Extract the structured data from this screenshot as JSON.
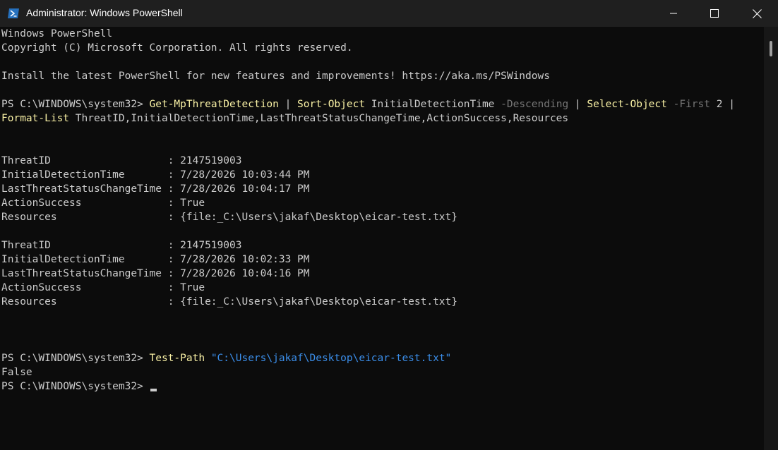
{
  "window": {
    "title": "Administrator: Windows PowerShell",
    "icon": "powershell-icon",
    "controls": [
      "minimize-icon",
      "maximize-icon",
      "close-icon"
    ]
  },
  "console": {
    "header": [
      "Windows PowerShell",
      "Copyright (C) Microsoft Corporation. All rights reserved.",
      "Install the latest PowerShell for new features and improvements! https://aka.ms/PSWindows"
    ],
    "prompt": "PS C:\\WINDOWS\\system32> ",
    "command1": {
      "cmd": "Get-MpThreatDetection",
      "pipe": " | ",
      "sort_cmd": "Sort-Object",
      "sort_arg": " InitialDetectionTime ",
      "sort_param": "-Descending",
      "select_cmd": "Select-Object",
      "select_param": "-First",
      "select_value": " 2 ",
      "pipe_end": "|",
      "format_cmd": "Format-List",
      "format_args": " ThreatID,InitialDetectionTime,LastThreatStatusChangeTime,ActionSuccess,Resources"
    },
    "result_lines": [
      "ThreatID                   : 2147519003",
      "InitialDetectionTime       : 7/28/2026 10:03:44 PM",
      "LastThreatStatusChangeTime : 7/28/2026 10:04:17 PM",
      "ActionSuccess              : True",
      "Resources                  : {file:_C:\\Users\\jakaf\\Desktop\\eicar-test.txt}",
      "ThreatID                   : 2147519003",
      "InitialDetectionTime       : 7/28/2026 10:02:33 PM",
      "LastThreatStatusChangeTime : 7/28/2026 10:04:16 PM",
      "ActionSuccess              : True",
      "Resources                  : {file:_C:\\Users\\jakaf\\Desktop\\eicar-test.txt}"
    ],
    "command2": {
      "cmd": "Test-Path",
      "arg": " \"C:\\Users\\jakaf\\Desktop\\eicar-test.txt\""
    },
    "command2_output": "False"
  }
}
